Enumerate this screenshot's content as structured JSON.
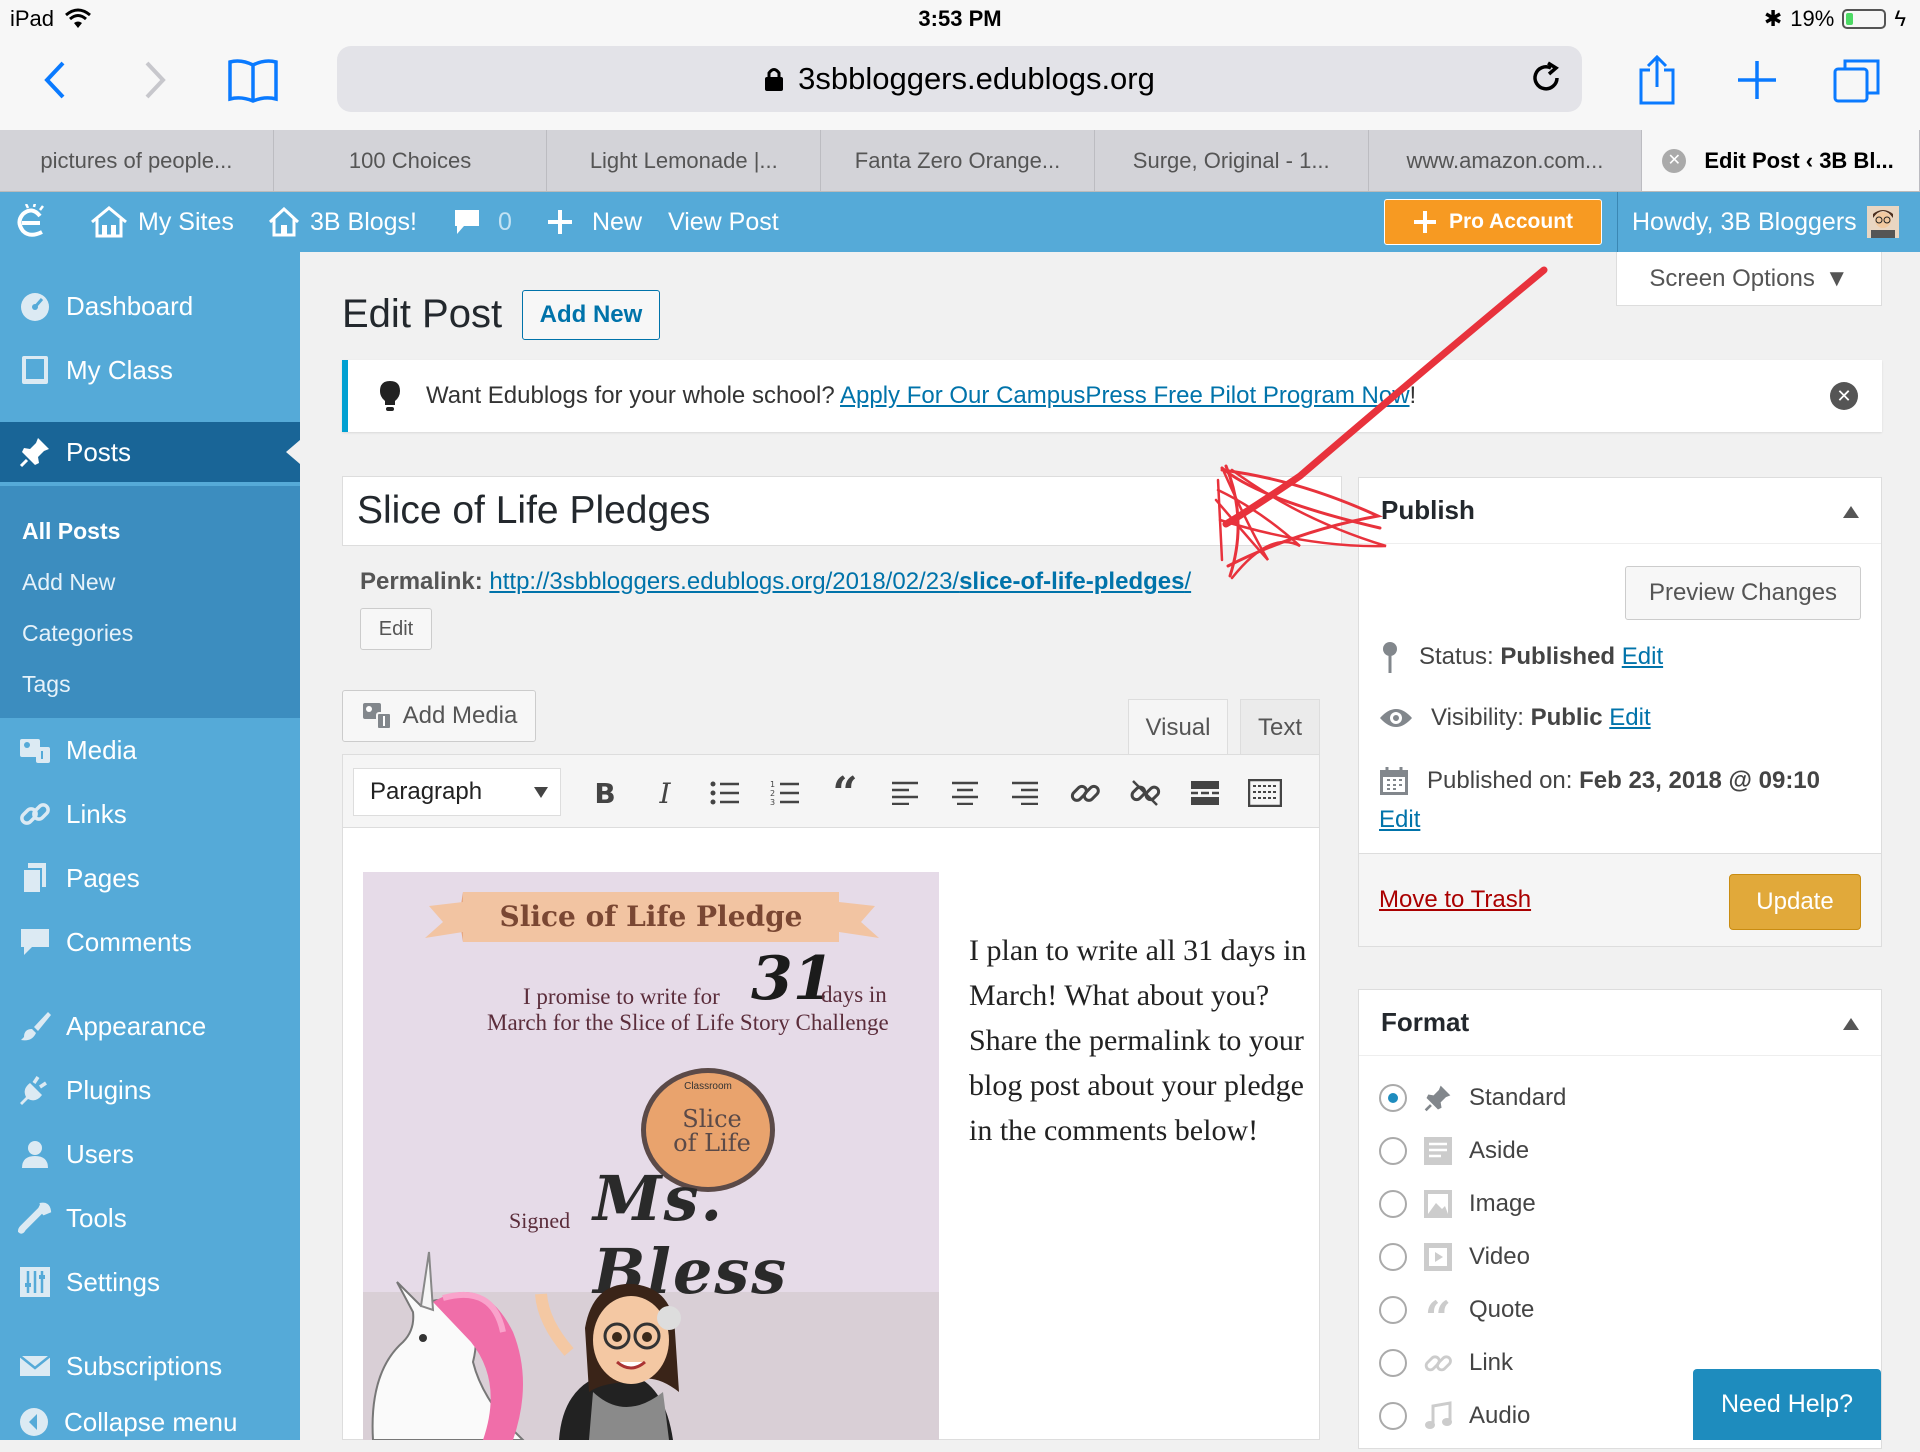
{
  "statusbar": {
    "device": "iPad",
    "time": "3:53 PM",
    "battery": "19%",
    "battery_level": 0.19
  },
  "browser": {
    "url": "3sbbloggers.edublogs.org",
    "tabs": [
      "pictures of people...",
      "100 Choices",
      "Light Lemonade |...",
      "Fanta Zero Orange...",
      "Surge, Original - 1...",
      "www.amazon.com...",
      "Edit Post ‹ 3B Bl..."
    ]
  },
  "adminbar": {
    "my_sites": "My Sites",
    "site_name": "3B Blogs!",
    "comments_count": "0",
    "new": "New",
    "view_post": "View Post",
    "pro_account": "Pro Account",
    "howdy": "Howdy, 3B Bloggers"
  },
  "sidebar": {
    "items": [
      "Dashboard",
      "My Class",
      "Posts",
      "Media",
      "Links",
      "Pages",
      "Comments",
      "Appearance",
      "Plugins",
      "Users",
      "Tools",
      "Settings",
      "Subscriptions",
      "Collapse menu"
    ],
    "submenu": [
      "All Posts",
      "Add New",
      "Categories",
      "Tags"
    ]
  },
  "main": {
    "title": "Edit Post",
    "add_new": "Add New",
    "screen_options": "Screen Options",
    "notice_text": "Want Edublogs for your whole school?",
    "notice_link": "Apply For Our CampusPress Free Pilot Program Now",
    "notice_end": "!",
    "post_title": "Slice of Life Pledges",
    "permalink_label": "Permalink:",
    "permalink_base": "http://3sbbloggers.edublogs.org/2018/02/23/",
    "permalink_slug": "slice-of-life-pledges",
    "permalink_end": "/",
    "edit": "Edit",
    "add_media": "Add Media",
    "tab_visual": "Visual",
    "tab_text": "Text",
    "format_select": "Paragraph",
    "editor_text": "I plan to write all 31 days in March!  What about you?  Share the permalink to your blog post about your pledge in the comments below!"
  },
  "pledge_image": {
    "banner": "Slice of Life Pledge",
    "line1_a": "I promise to write for",
    "line1_b": "days in",
    "days": "31",
    "line2": "March for the Slice of Life Story Challenge",
    "logo": "Slice of Life",
    "logo_top": "Classroom",
    "signed": "Signed",
    "signature": "Ms. Bless"
  },
  "publish": {
    "title": "Publish",
    "preview": "Preview Changes",
    "status_label": "Status:",
    "status_value": "Published",
    "visibility_label": "Visibility:",
    "visibility_value": "Public",
    "published_label": "Published on:",
    "published_value": "Feb 23, 2018 @ 09:10",
    "edit": "Edit",
    "trash": "Move to Trash",
    "update": "Update"
  },
  "format": {
    "title": "Format",
    "options": [
      "Standard",
      "Aside",
      "Image",
      "Video",
      "Quote",
      "Link",
      "Audio"
    ],
    "selected": "Standard"
  },
  "need_help": "Need Help?",
  "colors": {
    "wp_blue": "#55aad8",
    "wp_dark": "#196597",
    "pro_orange": "#f79a22",
    "update_gold": "#e1a93a",
    "annotation_red": "#e8323c"
  }
}
